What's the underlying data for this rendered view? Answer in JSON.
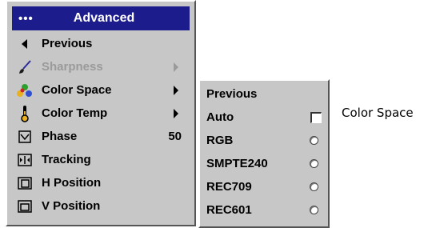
{
  "menu": {
    "header": {
      "dots": "•••",
      "title": "Advanced"
    },
    "items": [
      {
        "label": "Previous",
        "icon": "left-triangle-icon"
      },
      {
        "label": "Sharpness",
        "icon": "brush-icon",
        "disabled": true
      },
      {
        "label": "Color Space",
        "icon": "color-dots-icon"
      },
      {
        "label": "Color Temp",
        "icon": "thermometer-icon"
      },
      {
        "label": "Phase",
        "icon": "phase-icon",
        "value": "50"
      },
      {
        "label": "Tracking",
        "icon": "tracking-icon"
      },
      {
        "label": "H Position",
        "icon": "h-position-icon"
      },
      {
        "label": "V Position",
        "icon": "v-position-icon"
      }
    ]
  },
  "submenu": {
    "items": [
      {
        "label": "Previous"
      },
      {
        "label": "Auto",
        "control": "checkbox"
      },
      {
        "label": "RGB",
        "control": "radio"
      },
      {
        "label": "SMPTE240",
        "control": "radio"
      },
      {
        "label": "REC709",
        "control": "radio"
      },
      {
        "label": "REC601",
        "control": "radio"
      }
    ]
  },
  "side_label": "Color Space",
  "colors": {
    "menu_bg": "#c7c7c7",
    "header_bg": "#1c1c8c",
    "disabled_text": "#9a9a9a"
  }
}
